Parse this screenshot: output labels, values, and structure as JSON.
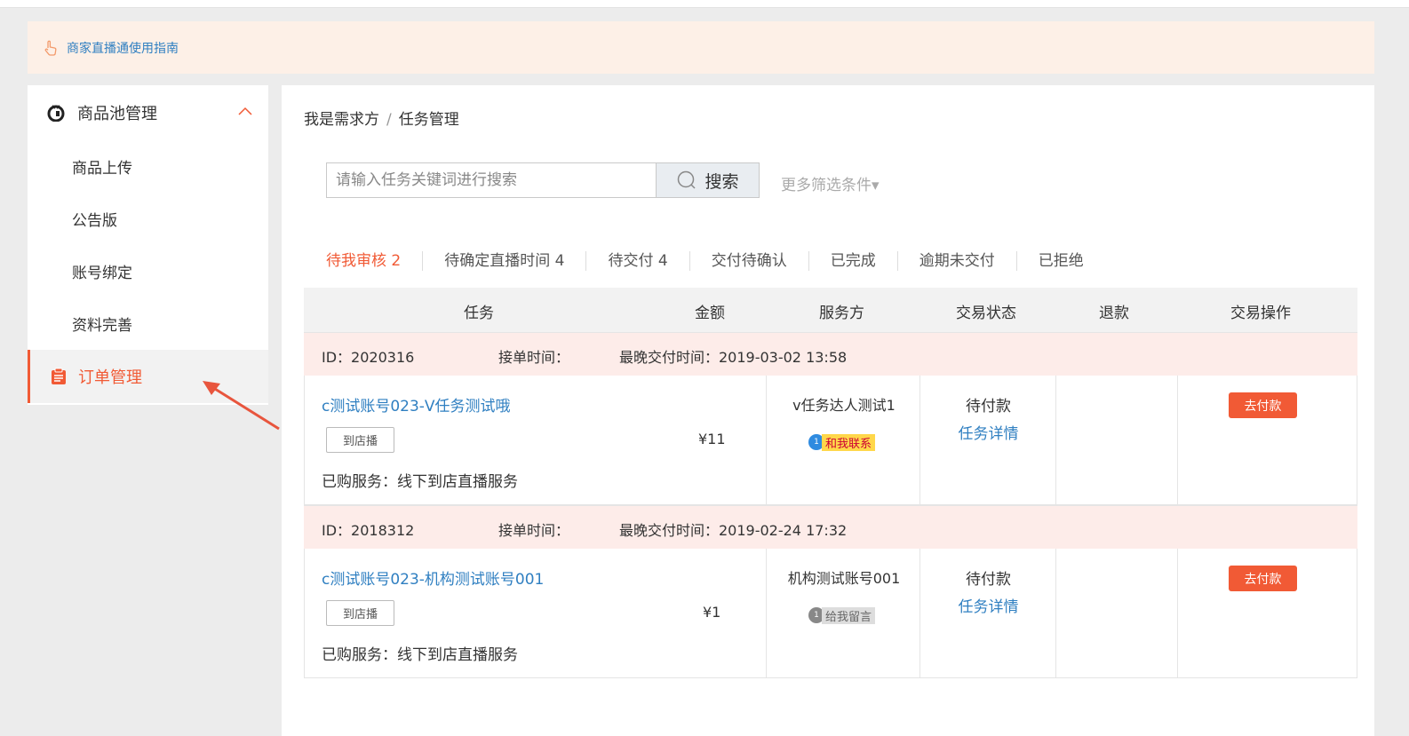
{
  "notice": {
    "text": "商家直播通使用指南"
  },
  "sidebar": {
    "group_title": "商品池管理",
    "items": [
      {
        "label": "商品上传"
      },
      {
        "label": "公告版"
      },
      {
        "label": "账号绑定"
      },
      {
        "label": "资料完善"
      }
    ],
    "active_item": "订单管理"
  },
  "breadcrumb": {
    "parent": "我是需求方",
    "separator": "/",
    "current": "任务管理"
  },
  "search": {
    "placeholder": "请输入任务关键词进行搜索",
    "button_label": "搜索",
    "more_filters": "更多筛选条件▾"
  },
  "tabs": [
    {
      "label": "待我审核 2",
      "active": true
    },
    {
      "label": "待确定直播时间 4"
    },
    {
      "label": "待交付 4"
    },
    {
      "label": "交付待确认"
    },
    {
      "label": "已完成"
    },
    {
      "label": "逾期未交付"
    },
    {
      "label": "已拒绝"
    }
  ],
  "table": {
    "columns": [
      "任务",
      "金额",
      "服务方",
      "交易状态",
      "退款",
      "交易操作"
    ],
    "rows": [
      {
        "id": "ID：2020316",
        "accept_time": "接单时间：",
        "deadline": "最晚交付时间：2019-03-02 13:58",
        "title": "c测试账号023-V任务测试哦",
        "tag": "到店播",
        "service": "已购服务：线下到店直播服务",
        "amount": "¥11",
        "provider": "v任务达人测试1",
        "contact_label": "和我联系",
        "status": "待付款",
        "detail_link": "任务详情",
        "action": "去付款"
      },
      {
        "id": "ID：2018312",
        "accept_time": "接单时间：",
        "deadline": "最晚交付时间：2019-02-24 17:32",
        "title": "c测试账号023-机构测试账号001",
        "tag": "到店播",
        "service": "已购服务：线下到店直播服务",
        "amount": "¥1",
        "provider": "机构测试账号001",
        "contact_label": "给我留言",
        "status": "待付款",
        "detail_link": "任务详情",
        "action": "去付款"
      }
    ]
  },
  "colors": {
    "accent": "#f15a35",
    "link": "#2f7fc1",
    "row_header_bg": "#fdece9",
    "notice_bg": "#fdf0e7"
  }
}
